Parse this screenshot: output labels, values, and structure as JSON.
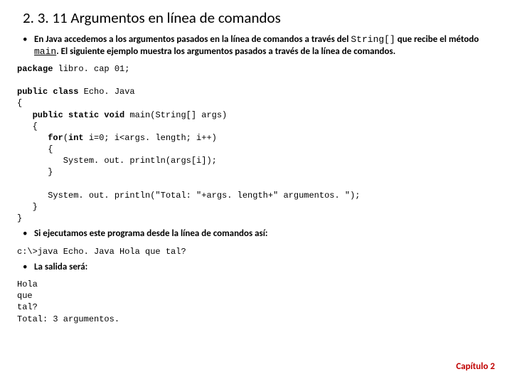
{
  "title": "2. 3. 11 Argumentos en línea de comandos",
  "bullet1_a": "En Java accedemos a los argumentos pasados en la línea de comandos a través del ",
  "bullet1_b": "String[]",
  "bullet1_c": " que recibe el método ",
  "bullet1_d": "main",
  "bullet1_e": ".  El siguiente ejemplo muestra los argumentos pasados a través de la línea de comandos.",
  "code": {
    "l1a": "package",
    "l1b": " libro. cap 01;",
    "l2a": "public class",
    "l2b": " Echo. Java",
    "l3": "{",
    "l4a": "   public static void",
    "l4b": " main(String[] args)",
    "l5": "   {",
    "l6a": "      for",
    "l6b": "(",
    "l6c": "int",
    "l6d": " i=0; i<args. length; i++)",
    "l7": "      {",
    "l8": "         System. out. println(args[i]);",
    "l9": "      }",
    "blank": "",
    "l10": "      System. out. println(\"Total: \"+args. length+\" argumentos. \");",
    "l11": "   }",
    "l12": "}"
  },
  "bullet2": "Si ejecutamos este programa desde la línea de comandos así:",
  "cmd": "c:\\>java Echo. Java Hola que tal?",
  "bullet3": "La salida será:",
  "output": "Hola\nque\ntal?\nTotal: 3 argumentos.",
  "footer": "Capítulo 2"
}
